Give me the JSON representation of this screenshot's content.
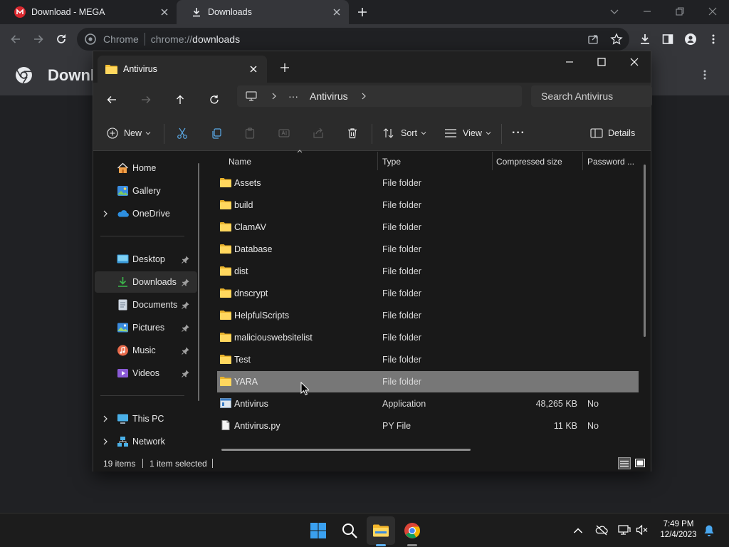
{
  "chrome": {
    "tabs": [
      {
        "label": "Download - MEGA",
        "active": false
      },
      {
        "label": "Downloads",
        "active": true
      }
    ],
    "omnibox": {
      "site_label": "Chrome",
      "url_scheme": "chrome://",
      "url_host": "downloads"
    },
    "page_title": "Downloads"
  },
  "explorer": {
    "tab_title": "Antivirus",
    "breadcrumb": {
      "more": "···",
      "current": "Antivirus"
    },
    "search_placeholder": "Search Antivirus",
    "commands": {
      "new": "New",
      "sort": "Sort",
      "view": "View",
      "more": "···",
      "details": "Details"
    },
    "nav": {
      "quick": [
        {
          "label": "Home",
          "icon": "home-icon"
        },
        {
          "label": "Gallery",
          "icon": "gallery-icon"
        },
        {
          "label": "OneDrive",
          "icon": "onedrive-icon",
          "expandable": true
        }
      ],
      "pinned": [
        {
          "label": "Desktop",
          "icon": "desktop-icon"
        },
        {
          "label": "Downloads",
          "icon": "downloads-icon",
          "selected": true
        },
        {
          "label": "Documents",
          "icon": "documents-icon"
        },
        {
          "label": "Pictures",
          "icon": "pictures-icon"
        },
        {
          "label": "Music",
          "icon": "music-icon"
        },
        {
          "label": "Videos",
          "icon": "videos-icon"
        }
      ],
      "locations": [
        {
          "label": "This PC",
          "icon": "this-pc-icon"
        },
        {
          "label": "Network",
          "icon": "network-icon"
        }
      ]
    },
    "columns": {
      "name": "Name",
      "type": "Type",
      "size": "Compressed size",
      "password": "Password ..."
    },
    "files": [
      {
        "name": "Assets",
        "type": "File folder",
        "size": "",
        "password": "",
        "icon": "folder-icon"
      },
      {
        "name": "build",
        "type": "File folder",
        "size": "",
        "password": "",
        "icon": "folder-icon"
      },
      {
        "name": "ClamAV",
        "type": "File folder",
        "size": "",
        "password": "",
        "icon": "folder-icon"
      },
      {
        "name": "Database",
        "type": "File folder",
        "size": "",
        "password": "",
        "icon": "folder-icon"
      },
      {
        "name": "dist",
        "type": "File folder",
        "size": "",
        "password": "",
        "icon": "folder-icon"
      },
      {
        "name": "dnscrypt",
        "type": "File folder",
        "size": "",
        "password": "",
        "icon": "folder-icon"
      },
      {
        "name": "HelpfulScripts",
        "type": "File folder",
        "size": "",
        "password": "",
        "icon": "folder-icon"
      },
      {
        "name": "maliciouswebsitelist",
        "type": "File folder",
        "size": "",
        "password": "",
        "icon": "folder-icon"
      },
      {
        "name": "Test",
        "type": "File folder",
        "size": "",
        "password": "",
        "icon": "folder-icon"
      },
      {
        "name": "YARA",
        "type": "File folder",
        "size": "",
        "password": "",
        "icon": "folder-icon",
        "selected": true
      },
      {
        "name": "Antivirus",
        "type": "Application",
        "size": "48,265 KB",
        "password": "No",
        "icon": "application-icon"
      },
      {
        "name": "Antivirus.py",
        "type": "PY File",
        "size": "11 KB",
        "password": "No",
        "icon": "file-icon"
      }
    ],
    "status": {
      "items": "19 items",
      "selected": "1 item selected"
    }
  },
  "taskbar": {
    "time": "7:49 PM",
    "date": "12/4/2023"
  }
}
